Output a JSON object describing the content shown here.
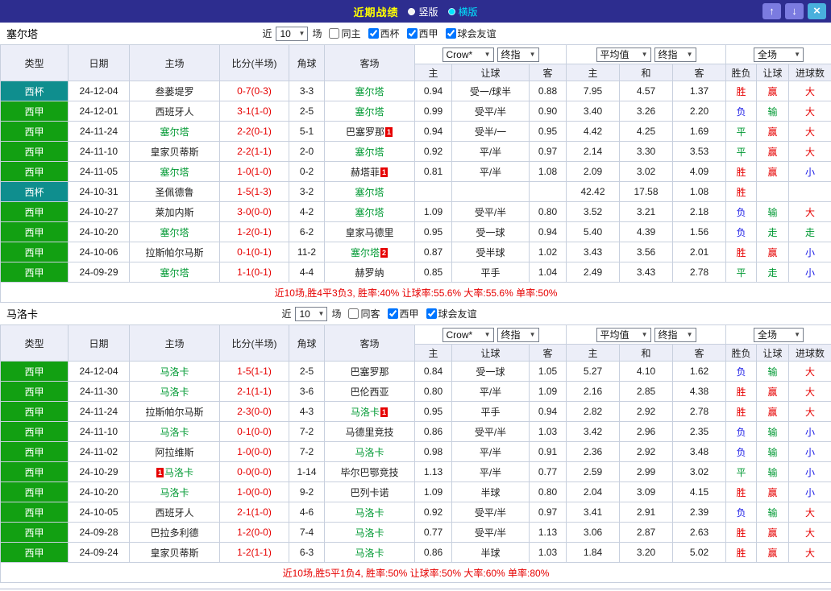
{
  "titlebar": {
    "title": "近期战绩",
    "vertical_label": "竖版",
    "horizontal_label": "横版",
    "selected_layout": "横版",
    "up_icon": "↑",
    "down_icon": "↓",
    "close_icon": "×"
  },
  "colors": {
    "win_red": "#e60000",
    "lose_blue": "#1a1ae6",
    "draw_green": "#009933",
    "laliga_badge_green": "#12a012",
    "cup_badge_teal": "#0f8e8e",
    "focus_team_green": "#009933",
    "titlebar_bg": "#2d2d8f",
    "title_yellow": "#ffff00",
    "selected_cyan": "#00e5ff",
    "header_bg": "#eceef8"
  },
  "table_headers": {
    "type": "类型",
    "date": "日期",
    "home": "主场",
    "score": "比分(半场)",
    "corner": "角球",
    "away": "客场",
    "odds_home": "主",
    "odds_handicap": "让球",
    "odds_away": "客",
    "avg_home": "主",
    "avg_draw": "和",
    "avg_away": "客",
    "result": "胜负",
    "handicap_result": "让球",
    "goals": "进球数"
  },
  "sections": [
    {
      "team": "塞尔塔",
      "filter": {
        "near": "近",
        "count": "10",
        "games": "场",
        "checkboxes": [
          {
            "key": "same-home",
            "label": "同主",
            "checked": false
          },
          {
            "key": "copa-del-rey",
            "label": "西杯",
            "checked": true
          },
          {
            "key": "la-liga",
            "label": "西甲",
            "checked": true
          },
          {
            "key": "club-friendly",
            "label": "球会友谊",
            "checked": true
          }
        ]
      },
      "dropdowns": [
        "Crow*",
        "终指",
        "平均值",
        "终指",
        "全场"
      ],
      "rows": [
        {
          "type": "西杯",
          "type_key": "cup",
          "date": "24-12-04",
          "home": {
            "name": "叁蒌堤罗",
            "focus": false
          },
          "score": "0-7(0-3)",
          "corner": "3-3",
          "away": {
            "name": "塞尔塔",
            "focus": true
          },
          "odds": [
            "0.94",
            "受一/球半",
            "0.88"
          ],
          "avg": [
            "7.95",
            "4.57",
            "1.37"
          ],
          "result": {
            "text": "胜",
            "cls": "red"
          },
          "hresult": {
            "text": "赢",
            "cls": "red"
          },
          "goals": {
            "text": "大",
            "cls": "red"
          }
        },
        {
          "type": "西甲",
          "type_key": "liga",
          "date": "24-12-01",
          "home": {
            "name": "西班牙人",
            "focus": false
          },
          "score": "3-1(1-0)",
          "corner": "2-5",
          "away": {
            "name": "塞尔塔",
            "focus": true
          },
          "odds": [
            "0.99",
            "受平/半",
            "0.90"
          ],
          "avg": [
            "3.40",
            "3.26",
            "2.20"
          ],
          "result": {
            "text": "负",
            "cls": "blue"
          },
          "hresult": {
            "text": "输",
            "cls": "green"
          },
          "goals": {
            "text": "大",
            "cls": "red"
          }
        },
        {
          "type": "西甲",
          "type_key": "liga",
          "date": "24-11-24",
          "home": {
            "name": "塞尔塔",
            "focus": true
          },
          "score": "2-2(0-1)",
          "corner": "5-1",
          "away": {
            "name": "巴塞罗那",
            "focus": false,
            "card": "1",
            "card_pos": "after"
          },
          "odds": [
            "0.94",
            "受半/一",
            "0.95"
          ],
          "avg": [
            "4.42",
            "4.25",
            "1.69"
          ],
          "result": {
            "text": "平",
            "cls": "green"
          },
          "hresult": {
            "text": "赢",
            "cls": "red"
          },
          "goals": {
            "text": "大",
            "cls": "red"
          }
        },
        {
          "type": "西甲",
          "type_key": "liga",
          "date": "24-11-10",
          "home": {
            "name": "皇家贝蒂斯",
            "focus": false
          },
          "score": "2-2(1-1)",
          "corner": "2-0",
          "away": {
            "name": "塞尔塔",
            "focus": true
          },
          "odds": [
            "0.92",
            "平/半",
            "0.97"
          ],
          "avg": [
            "2.14",
            "3.30",
            "3.53"
          ],
          "result": {
            "text": "平",
            "cls": "green"
          },
          "hresult": {
            "text": "赢",
            "cls": "red"
          },
          "goals": {
            "text": "大",
            "cls": "red"
          }
        },
        {
          "type": "西甲",
          "type_key": "liga",
          "date": "24-11-05",
          "home": {
            "name": "塞尔塔",
            "focus": true
          },
          "score": "1-0(1-0)",
          "corner": "0-2",
          "away": {
            "name": "赫塔菲",
            "focus": false,
            "card": "1",
            "card_pos": "after"
          },
          "odds": [
            "0.81",
            "平/半",
            "1.08"
          ],
          "avg": [
            "2.09",
            "3.02",
            "4.09"
          ],
          "result": {
            "text": "胜",
            "cls": "red"
          },
          "hresult": {
            "text": "赢",
            "cls": "red"
          },
          "goals": {
            "text": "小",
            "cls": "blue"
          }
        },
        {
          "type": "西杯",
          "type_key": "cup",
          "date": "24-10-31",
          "home": {
            "name": "圣佩德鲁",
            "focus": false
          },
          "score": "1-5(1-3)",
          "corner": "3-2",
          "away": {
            "name": "塞尔塔",
            "focus": true
          },
          "odds": [
            "",
            "",
            ""
          ],
          "avg": [
            "42.42",
            "17.58",
            "1.08"
          ],
          "result": {
            "text": "胜",
            "cls": "red"
          },
          "hresult": {
            "text": "",
            "cls": ""
          },
          "goals": {
            "text": "",
            "cls": ""
          }
        },
        {
          "type": "西甲",
          "type_key": "liga",
          "date": "24-10-27",
          "home": {
            "name": "莱加内斯",
            "focus": false
          },
          "score": "3-0(0-0)",
          "corner": "4-2",
          "away": {
            "name": "塞尔塔",
            "focus": true
          },
          "odds": [
            "1.09",
            "受平/半",
            "0.80"
          ],
          "avg": [
            "3.52",
            "3.21",
            "2.18"
          ],
          "result": {
            "text": "负",
            "cls": "blue"
          },
          "hresult": {
            "text": "输",
            "cls": "green"
          },
          "goals": {
            "text": "大",
            "cls": "red"
          }
        },
        {
          "type": "西甲",
          "type_key": "liga",
          "date": "24-10-20",
          "home": {
            "name": "塞尔塔",
            "focus": true
          },
          "score": "1-2(0-1)",
          "corner": "6-2",
          "away": {
            "name": "皇家马德里",
            "focus": false
          },
          "odds": [
            "0.95",
            "受一球",
            "0.94"
          ],
          "avg": [
            "5.40",
            "4.39",
            "1.56"
          ],
          "result": {
            "text": "负",
            "cls": "blue"
          },
          "hresult": {
            "text": "走",
            "cls": "green"
          },
          "goals": {
            "text": "走",
            "cls": "green"
          }
        },
        {
          "type": "西甲",
          "type_key": "liga",
          "date": "24-10-06",
          "home": {
            "name": "拉斯帕尔马斯",
            "focus": false
          },
          "score": "0-1(0-1)",
          "corner": "11-2",
          "away": {
            "name": "塞尔塔",
            "focus": true,
            "card": "2",
            "card_pos": "after"
          },
          "odds": [
            "0.87",
            "受半球",
            "1.02"
          ],
          "avg": [
            "3.43",
            "3.56",
            "2.01"
          ],
          "result": {
            "text": "胜",
            "cls": "red"
          },
          "hresult": {
            "text": "赢",
            "cls": "red"
          },
          "goals": {
            "text": "小",
            "cls": "blue"
          }
        },
        {
          "type": "西甲",
          "type_key": "liga",
          "date": "24-09-29",
          "home": {
            "name": "塞尔塔",
            "focus": true
          },
          "score": "1-1(0-1)",
          "corner": "4-4",
          "away": {
            "name": "赫罗纳",
            "focus": false
          },
          "odds": [
            "0.85",
            "平手",
            "1.04"
          ],
          "avg": [
            "2.49",
            "3.43",
            "2.78"
          ],
          "result": {
            "text": "平",
            "cls": "green"
          },
          "hresult": {
            "text": "走",
            "cls": "green"
          },
          "goals": {
            "text": "小",
            "cls": "blue"
          }
        }
      ],
      "summary": "近10场,胜4平3负3, 胜率:40% 让球率:55.6% 大率:55.6% 单率:50%"
    },
    {
      "team": "马洛卡",
      "filter": {
        "near": "近",
        "count": "10",
        "games": "场",
        "checkboxes": [
          {
            "key": "same-away",
            "label": "同客",
            "checked": false
          },
          {
            "key": "la-liga",
            "label": "西甲",
            "checked": true
          },
          {
            "key": "club-friendly",
            "label": "球会友谊",
            "checked": true
          }
        ]
      },
      "dropdowns": [
        "Crow*",
        "终指",
        "平均值",
        "终指",
        "全场"
      ],
      "rows": [
        {
          "type": "西甲",
          "type_key": "liga",
          "date": "24-12-04",
          "home": {
            "name": "马洛卡",
            "focus": true
          },
          "score": "1-5(1-1)",
          "corner": "2-5",
          "away": {
            "name": "巴塞罗那",
            "focus": false
          },
          "odds": [
            "0.84",
            "受一球",
            "1.05"
          ],
          "avg": [
            "5.27",
            "4.10",
            "1.62"
          ],
          "result": {
            "text": "负",
            "cls": "blue"
          },
          "hresult": {
            "text": "输",
            "cls": "green"
          },
          "goals": {
            "text": "大",
            "cls": "red"
          }
        },
        {
          "type": "西甲",
          "type_key": "liga",
          "date": "24-11-30",
          "home": {
            "name": "马洛卡",
            "focus": true
          },
          "score": "2-1(1-1)",
          "corner": "3-6",
          "away": {
            "name": "巴伦西亚",
            "focus": false
          },
          "odds": [
            "0.80",
            "平/半",
            "1.09"
          ],
          "avg": [
            "2.16",
            "2.85",
            "4.38"
          ],
          "result": {
            "text": "胜",
            "cls": "red"
          },
          "hresult": {
            "text": "赢",
            "cls": "red"
          },
          "goals": {
            "text": "大",
            "cls": "red"
          }
        },
        {
          "type": "西甲",
          "type_key": "liga",
          "date": "24-11-24",
          "home": {
            "name": "拉斯帕尔马斯",
            "focus": false
          },
          "score": "2-3(0-0)",
          "corner": "4-3",
          "away": {
            "name": "马洛卡",
            "focus": true,
            "card": "1",
            "card_pos": "after"
          },
          "odds": [
            "0.95",
            "平手",
            "0.94"
          ],
          "avg": [
            "2.82",
            "2.92",
            "2.78"
          ],
          "result": {
            "text": "胜",
            "cls": "red"
          },
          "hresult": {
            "text": "赢",
            "cls": "red"
          },
          "goals": {
            "text": "大",
            "cls": "red"
          }
        },
        {
          "type": "西甲",
          "type_key": "liga",
          "date": "24-11-10",
          "home": {
            "name": "马洛卡",
            "focus": true
          },
          "score": "0-1(0-0)",
          "corner": "7-2",
          "away": {
            "name": "马德里竞技",
            "focus": false
          },
          "odds": [
            "0.86",
            "受平/半",
            "1.03"
          ],
          "avg": [
            "3.42",
            "2.96",
            "2.35"
          ],
          "result": {
            "text": "负",
            "cls": "blue"
          },
          "hresult": {
            "text": "输",
            "cls": "green"
          },
          "goals": {
            "text": "小",
            "cls": "blue"
          }
        },
        {
          "type": "西甲",
          "type_key": "liga",
          "date": "24-11-02",
          "home": {
            "name": "阿拉维斯",
            "focus": false
          },
          "score": "1-0(0-0)",
          "corner": "7-2",
          "away": {
            "name": "马洛卡",
            "focus": true
          },
          "odds": [
            "0.98",
            "平/半",
            "0.91"
          ],
          "avg": [
            "2.36",
            "2.92",
            "3.48"
          ],
          "result": {
            "text": "负",
            "cls": "blue"
          },
          "hresult": {
            "text": "输",
            "cls": "green"
          },
          "goals": {
            "text": "小",
            "cls": "blue"
          }
        },
        {
          "type": "西甲",
          "type_key": "liga",
          "date": "24-10-29",
          "home": {
            "name": "马洛卡",
            "focus": true,
            "card": "1",
            "card_pos": "before"
          },
          "score": "0-0(0-0)",
          "corner": "1-14",
          "away": {
            "name": "毕尔巴鄂竞技",
            "focus": false
          },
          "odds": [
            "1.13",
            "平/半",
            "0.77"
          ],
          "avg": [
            "2.59",
            "2.99",
            "3.02"
          ],
          "result": {
            "text": "平",
            "cls": "green"
          },
          "hresult": {
            "text": "输",
            "cls": "green"
          },
          "goals": {
            "text": "小",
            "cls": "blue"
          }
        },
        {
          "type": "西甲",
          "type_key": "liga",
          "date": "24-10-20",
          "home": {
            "name": "马洛卡",
            "focus": true
          },
          "score": "1-0(0-0)",
          "corner": "9-2",
          "away": {
            "name": "巴列卡诺",
            "focus": false
          },
          "odds": [
            "1.09",
            "半球",
            "0.80"
          ],
          "avg": [
            "2.04",
            "3.09",
            "4.15"
          ],
          "result": {
            "text": "胜",
            "cls": "red"
          },
          "hresult": {
            "text": "赢",
            "cls": "red"
          },
          "goals": {
            "text": "小",
            "cls": "blue"
          }
        },
        {
          "type": "西甲",
          "type_key": "liga",
          "date": "24-10-05",
          "home": {
            "name": "西班牙人",
            "focus": false
          },
          "score": "2-1(1-0)",
          "corner": "4-6",
          "away": {
            "name": "马洛卡",
            "focus": true
          },
          "odds": [
            "0.92",
            "受平/半",
            "0.97"
          ],
          "avg": [
            "3.41",
            "2.91",
            "2.39"
          ],
          "result": {
            "text": "负",
            "cls": "blue"
          },
          "hresult": {
            "text": "输",
            "cls": "green"
          },
          "goals": {
            "text": "大",
            "cls": "red"
          }
        },
        {
          "type": "西甲",
          "type_key": "liga",
          "date": "24-09-28",
          "home": {
            "name": "巴拉多利德",
            "focus": false
          },
          "score": "1-2(0-0)",
          "corner": "7-4",
          "away": {
            "name": "马洛卡",
            "focus": true
          },
          "odds": [
            "0.77",
            "受平/半",
            "1.13"
          ],
          "avg": [
            "3.06",
            "2.87",
            "2.63"
          ],
          "result": {
            "text": "胜",
            "cls": "red"
          },
          "hresult": {
            "text": "赢",
            "cls": "red"
          },
          "goals": {
            "text": "大",
            "cls": "red"
          }
        },
        {
          "type": "西甲",
          "type_key": "liga",
          "date": "24-09-24",
          "home": {
            "name": "皇家贝蒂斯",
            "focus": false
          },
          "score": "1-2(1-1)",
          "corner": "6-3",
          "away": {
            "name": "马洛卡",
            "focus": true
          },
          "odds": [
            "0.86",
            "半球",
            "1.03"
          ],
          "avg": [
            "1.84",
            "3.20",
            "5.02"
          ],
          "result": {
            "text": "胜",
            "cls": "red"
          },
          "hresult": {
            "text": "赢",
            "cls": "red"
          },
          "goals": {
            "text": "大",
            "cls": "red"
          }
        }
      ],
      "summary": "近10场,胜5平1负4, 胜率:50% 让球率:50% 大率:60% 单率:80%"
    }
  ]
}
